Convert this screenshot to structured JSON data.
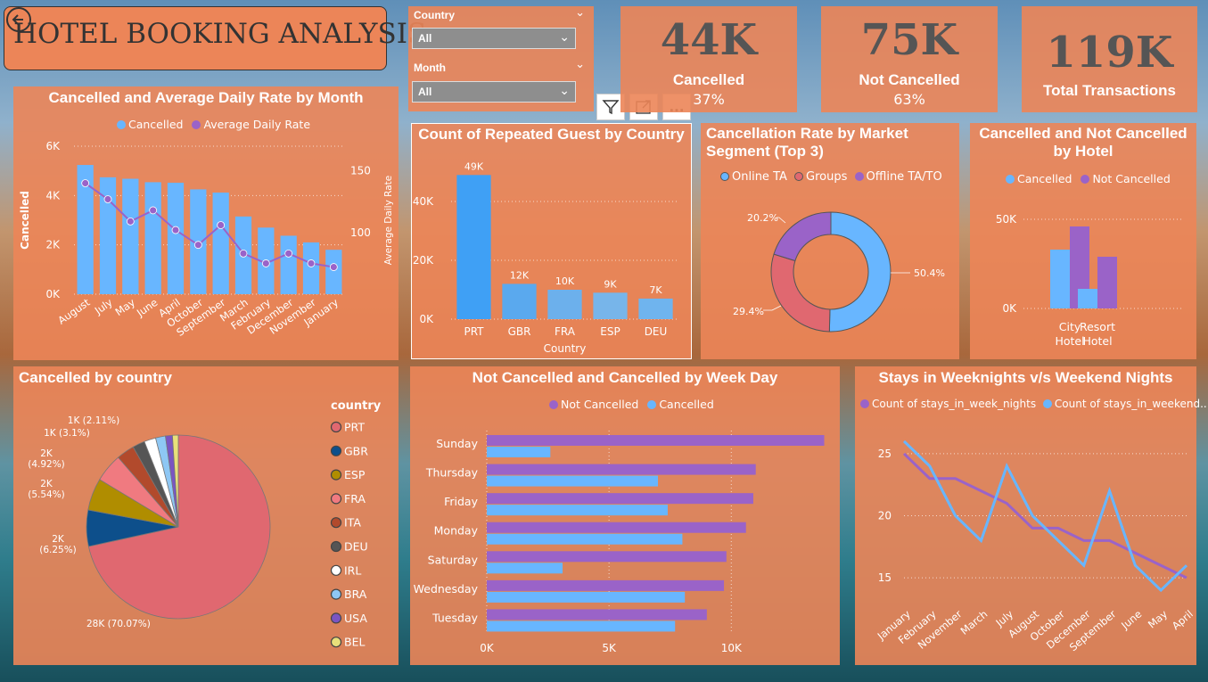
{
  "header": {
    "title": "HOTEL BOOKING ANALYSIS"
  },
  "slicers": [
    {
      "label": "Country",
      "value": "All"
    },
    {
      "label": "Month",
      "value": "All"
    }
  ],
  "visual_toolbar": {
    "filter": "filter",
    "focus": "focus mode",
    "more": "..."
  },
  "kpis": [
    {
      "value": "44K",
      "label": "Cancelled",
      "pct": "37%"
    },
    {
      "value": "75K",
      "label": "Not Cancelled",
      "pct": "63%"
    },
    {
      "value": "119K",
      "label": "Total Transactions"
    }
  ],
  "colors": {
    "blue": "#68b6ff",
    "purple": "#9a63c8",
    "panel": "#ec8558",
    "pink": "#e06870"
  },
  "c1": {
    "title": "Cancelled and Average Daily Rate by Month",
    "legend": [
      "Cancelled",
      "Average Daily Rate"
    ],
    "ylabel": "Cancelled",
    "y2label": "Average Daily Rate",
    "yticks": [
      "6K",
      "4K",
      "2K",
      "0K"
    ],
    "y2ticks": [
      "150",
      "100"
    ]
  },
  "c2": {
    "title": "Count of Repeated Guest by Country",
    "xlabel": "Country",
    "yticks": [
      "40K",
      "20K",
      "0K"
    ]
  },
  "c3": {
    "title": "Cancellation Rate by Market Segment (Top 3)",
    "legend": [
      "Online TA",
      "Groups",
      "Offline TA/TO"
    ]
  },
  "c4": {
    "title": "Cancelled and Not Cancelled by Hotel",
    "legend": [
      "Cancelled",
      "Not Cancelled"
    ],
    "yticks": [
      "50K",
      "0K"
    ]
  },
  "c5": {
    "title": "Cancelled by country",
    "legend_title": "country"
  },
  "c6": {
    "title": "Not Cancelled and Cancelled by Week Day",
    "legend": [
      "Not Cancelled",
      "Cancelled"
    ],
    "xticks": [
      "0K",
      "5K",
      "10K"
    ]
  },
  "c7": {
    "title": "Stays in Weeknights v/s Weekend Nights",
    "legend": [
      "Count of stays_in_week_nights",
      "Count of stays_in_weekend..."
    ],
    "yticks": [
      "25",
      "20",
      "15"
    ]
  },
  "chart_data": [
    {
      "type": "bar",
      "title": "Cancelled and Average Daily Rate by Month",
      "categories": [
        "August",
        "July",
        "May",
        "June",
        "April",
        "October",
        "September",
        "March",
        "February",
        "December",
        "November",
        "January"
      ],
      "series": [
        {
          "name": "Cancelled",
          "values": [
            5.24,
            4.74,
            4.68,
            4.54,
            4.52,
            4.25,
            4.12,
            3.15,
            2.7,
            2.37,
            2.1,
            1.8
          ]
        },
        {
          "name": "Average Daily Rate",
          "values": [
            140,
            127,
            109,
            118,
            102,
            90,
            106,
            83,
            75,
            83,
            75,
            72
          ]
        }
      ],
      "ylabel": "Cancelled",
      "ylim": [
        0,
        6
      ],
      "y2label": "Average Daily Rate",
      "y2lim": [
        50,
        170
      ]
    },
    {
      "type": "bar",
      "title": "Count of Repeated Guest by Country",
      "categories": [
        "PRT",
        "GBR",
        "FRA",
        "ESP",
        "DEU"
      ],
      "values": [
        49,
        12,
        10,
        9,
        7
      ],
      "data_labels": [
        "49K",
        "12K",
        "10K",
        "9K",
        "7K"
      ],
      "xlabel": "Country",
      "ylim": [
        0,
        50
      ]
    },
    {
      "type": "pie",
      "title": "Cancellation Rate by Market Segment (Top 3)",
      "categories": [
        "Online TA",
        "Groups",
        "Offline TA/TO"
      ],
      "values": [
        50.4,
        29.4,
        20.2
      ],
      "data_labels": [
        "50.4%",
        "29.4%",
        "20.2%"
      ]
    },
    {
      "type": "bar",
      "title": "Cancelled and Not Cancelled by Hotel",
      "categories": [
        "City Hotel",
        "Resort Hotel"
      ],
      "series": [
        {
          "name": "Cancelled",
          "values": [
            33,
            11
          ]
        },
        {
          "name": "Not Cancelled",
          "values": [
            46,
            29
          ]
        }
      ],
      "ylim": [
        0,
        50
      ]
    },
    {
      "type": "pie",
      "title": "Cancelled by country",
      "categories": [
        "PRT",
        "GBR",
        "ESP",
        "FRA",
        "ITA",
        "DEU",
        "IRL",
        "BRA",
        "USA",
        "BEL"
      ],
      "values": [
        70.07,
        6.25,
        5.54,
        4.92,
        3.1,
        2.11,
        2.0,
        1.7,
        1.2,
        1.0
      ],
      "data_labels": [
        "28K (70.07%)",
        "2K (6.25%)",
        "2K (5.54%)",
        "2K (4.92%)",
        "1K (3.1%)",
        "1K (2.11%)"
      ],
      "legend_colors": [
        "#e06870",
        "#0d4f8b",
        "#b08d00",
        "#f07a80",
        "#b24a2c",
        "#555555",
        "#ffffff",
        "#8ec7f4",
        "#7a55c2",
        "#e8e07a"
      ]
    },
    {
      "type": "bar",
      "orientation": "horizontal",
      "title": "Not Cancelled and Cancelled by Week Day",
      "categories": [
        "Sunday",
        "Thursday",
        "Friday",
        "Monday",
        "Saturday",
        "Wednesday",
        "Tuesday"
      ],
      "series": [
        {
          "name": "Not Cancelled",
          "values": [
            13.8,
            11.0,
            10.9,
            10.6,
            9.8,
            9.7,
            9.0
          ]
        },
        {
          "name": "Cancelled",
          "values": [
            2.6,
            7.0,
            7.4,
            8.0,
            3.1,
            8.1,
            7.7
          ]
        }
      ],
      "xlim": [
        0,
        14
      ]
    },
    {
      "type": "line",
      "title": "Stays in Weeknights v/s Weekend Nights",
      "categories": [
        "January",
        "February",
        "November",
        "March",
        "July",
        "August",
        "October",
        "December",
        "September",
        "June",
        "May",
        "April"
      ],
      "series": [
        {
          "name": "Count of stays_in_week_nights",
          "values": [
            25.0,
            23.0,
            23.0,
            22.0,
            21.0,
            19.0,
            19.0,
            18.0,
            18.0,
            17.0,
            16.0,
            15.0
          ]
        },
        {
          "name": "Count of stays_in_weekend...",
          "values": [
            26.0,
            24.0,
            20.0,
            18.0,
            24.0,
            20.0,
            18.0,
            16.0,
            22.0,
            16.0,
            14.0,
            16.0
          ]
        }
      ],
      "ylim": [
        13,
        27
      ]
    }
  ]
}
